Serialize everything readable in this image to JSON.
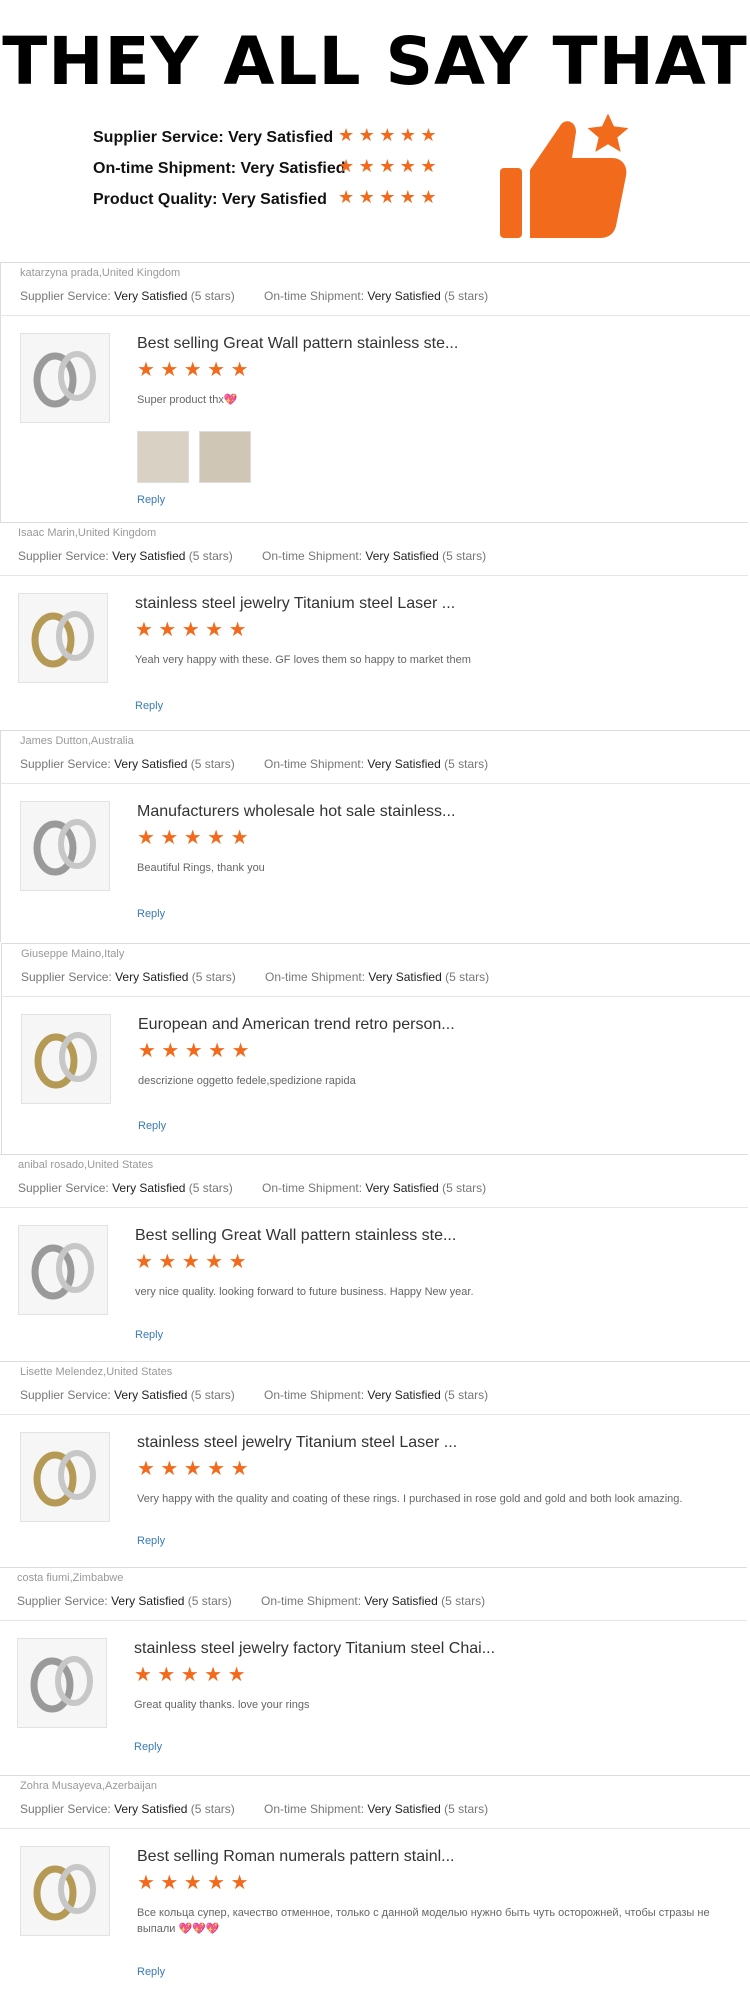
{
  "header": {
    "headline": "THEY ALL SAY THAT",
    "summary": [
      {
        "label": "Supplier Service: Very Satisfied",
        "stars": 5
      },
      {
        "label": "On-time Shipment: Very Satisfied",
        "stars": 5
      },
      {
        "label": "Product Quality: Very Satisfied",
        "stars": 5
      }
    ],
    "icon": "thumbs-up-star-icon",
    "accent_color": "#f26b1d"
  },
  "rating_labels": {
    "supplier": "Supplier Service:",
    "shipment": "On-time Shipment:",
    "value": "Very Satisfied",
    "stars_note": "(5 stars)"
  },
  "reply_label": "Reply",
  "reviews": [
    {
      "reviewer": "katarzyna prada,United Kingdom",
      "title": "Best selling Great Wall pattern stainless ste...",
      "stars": 5,
      "comment": "Super product thx💖",
      "photos": 2
    },
    {
      "reviewer": "Isaac Marin,United Kingdom",
      "title": "stainless steel jewelry Titanium steel Laser ...",
      "stars": 5,
      "comment": "Yeah very happy with these. GF loves them so happy to market them",
      "photos": 0
    },
    {
      "reviewer": "James Dutton,Australia",
      "title": "Manufacturers wholesale hot sale stainless...",
      "stars": 5,
      "comment": "Beautiful Rings, thank you",
      "photos": 0
    },
    {
      "reviewer": "Giuseppe Maino,Italy",
      "title": "European and American trend retro person...",
      "stars": 5,
      "comment": "descrizione oggetto fedele,spedizione rapida",
      "photos": 0
    },
    {
      "reviewer": "anibal rosado,United States",
      "title": "Best selling Great Wall pattern stainless ste...",
      "stars": 5,
      "comment": "very nice quality.  looking forward to future business.  Happy New year.",
      "photos": 0
    },
    {
      "reviewer": "Lisette Melendez,United States",
      "title": "stainless steel jewelry Titanium steel Laser ...",
      "stars": 5,
      "comment": "Very happy with the quality and coating of these rings. I purchased in rose gold and gold and both look amazing.",
      "photos": 0
    },
    {
      "reviewer": "costa fiumi,Zimbabwe",
      "title": "stainless steel jewelry factory Titanium steel Chai...",
      "stars": 5,
      "comment": "Great quality thanks. love your rings",
      "photos": 0
    },
    {
      "reviewer": "Zohra Musayeva,Azerbaijan",
      "title": "Best selling Roman numerals pattern stainl...",
      "stars": 5,
      "comment": "Все кольца супер, качество отменное, только с данной моделью нужно быть чуть осторожней, чтобы стразы не выпали 💖💖💖",
      "photos": 0
    }
  ]
}
